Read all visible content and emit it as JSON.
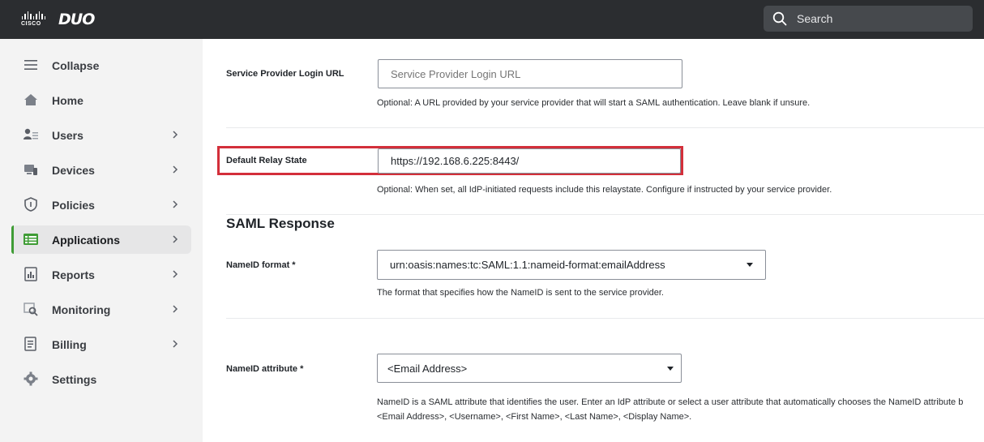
{
  "header": {
    "brand_cisco": "CISCO",
    "brand_duo": "DUO",
    "search_label": "Search"
  },
  "sidebar": {
    "items": [
      {
        "label": "Collapse",
        "icon": "menu-icon"
      },
      {
        "label": "Home",
        "icon": "home-icon"
      },
      {
        "label": "Users",
        "icon": "users-icon",
        "has_submenu": true
      },
      {
        "label": "Devices",
        "icon": "devices-icon",
        "has_submenu": true
      },
      {
        "label": "Policies",
        "icon": "shield-icon",
        "has_submenu": true
      },
      {
        "label": "Applications",
        "icon": "applications-icon",
        "has_submenu": true,
        "active": true
      },
      {
        "label": "Reports",
        "icon": "reports-icon",
        "has_submenu": true
      },
      {
        "label": "Monitoring",
        "icon": "monitoring-icon",
        "has_submenu": true
      },
      {
        "label": "Billing",
        "icon": "billing-icon",
        "has_submenu": true
      },
      {
        "label": "Settings",
        "icon": "gear-icon"
      }
    ],
    "active_color": "#3f9c35"
  },
  "form": {
    "sp_login_url": {
      "label": "Service Provider Login URL",
      "placeholder": "Service Provider Login URL",
      "help": "Optional: A URL provided by your service provider that will start a SAML authentication. Leave blank if unsure."
    },
    "relay_state": {
      "label": "Default Relay State",
      "value": "https://192.168.6.225:8443/",
      "help": "Optional: When set, all IdP-initiated requests include this relaystate. Configure if instructed by your service provider.",
      "highlight_color": "#d32f3a"
    },
    "saml_response": {
      "title": "SAML Response"
    },
    "nameid_format": {
      "label": "NameID format  *",
      "value": "urn:oasis:names:tc:SAML:1.1:nameid-format:emailAddress",
      "help": "The format that specifies how the NameID is sent to the service provider."
    },
    "nameid_attribute": {
      "label": "NameID attribute *",
      "value": "<Email Address>",
      "help_line1": "NameID is a SAML attribute that identifies the user. Enter an IdP attribute or select a user attribute that automatically chooses the NameID attribute b",
      "help_line2": "<Email Address>, <Username>, <First Name>, <Last Name>, <Display Name>."
    }
  }
}
